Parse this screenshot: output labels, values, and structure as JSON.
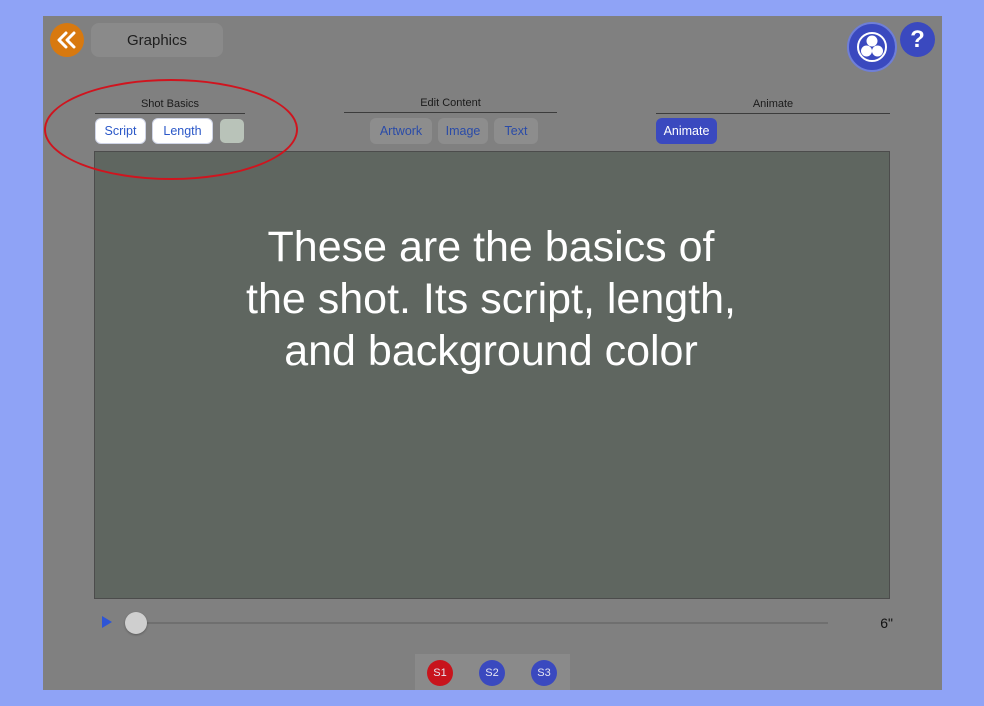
{
  "header": {
    "title": "Graphics",
    "back_icon": "double-chevron-left-icon",
    "logo_icon": "three-circles-logo-icon",
    "help_label": "?"
  },
  "sections": {
    "shot_basics": {
      "title": "Shot Basics",
      "script_label": "Script",
      "length_label": "Length",
      "background_color": "#b9c3b9"
    },
    "edit_content": {
      "title": "Edit Content",
      "artwork_label": "Artwork",
      "image_label": "Image",
      "text_label": "Text"
    },
    "animate": {
      "title": "Animate",
      "animate_label": "Animate"
    }
  },
  "overlay": {
    "message": "These are the basics of\nthe shot. Its script, length,\nand background color"
  },
  "timeline": {
    "length": "6\"",
    "progress": 0
  },
  "shots": [
    {
      "label": "S1",
      "color": "#c8141c"
    },
    {
      "label": "S2",
      "color": "#3a49bf"
    },
    {
      "label": "S3",
      "color": "#3a49bf"
    }
  ],
  "colors": {
    "accent_orange": "#d8790f",
    "accent_blue": "#3a49bf",
    "highlight_red": "#d0141e",
    "canvas": "#5f6660"
  }
}
